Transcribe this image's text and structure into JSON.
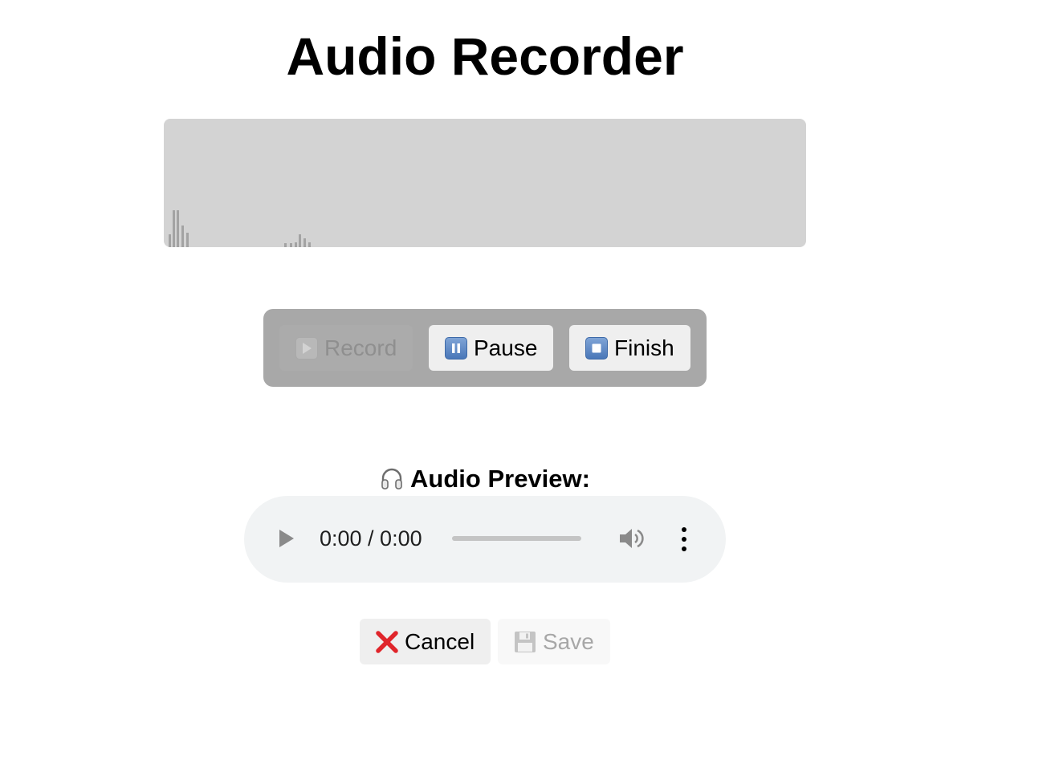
{
  "header": {
    "title": "Audio Recorder"
  },
  "visualizer": {
    "levels": [
      0.1,
      0.29,
      0.29,
      0.17,
      0.11,
      0.03,
      0.03,
      0.04,
      0.1,
      0.07,
      0.04
    ]
  },
  "controls": {
    "record_label": "Record",
    "record_icon": "play-icon",
    "record_enabled": false,
    "pause_label": "Pause",
    "pause_icon": "pause-icon",
    "finish_label": "Finish",
    "finish_icon": "stop-icon"
  },
  "preview": {
    "icon": "headphones-icon",
    "label": "Audio Preview:",
    "time_display": "0:00 / 0:00",
    "progress": 0
  },
  "actions": {
    "cancel_label": "Cancel",
    "cancel_icon": "cross-mark-icon",
    "save_label": "Save",
    "save_icon": "floppy-disk-icon",
    "save_enabled": false
  },
  "colors": {
    "visualizer_bg": "#d3d3d3",
    "controls_bg": "#a8a8a8",
    "button_bg": "#efefef",
    "player_bg": "#f1f3f4",
    "cancel_red": "#e0252b"
  }
}
